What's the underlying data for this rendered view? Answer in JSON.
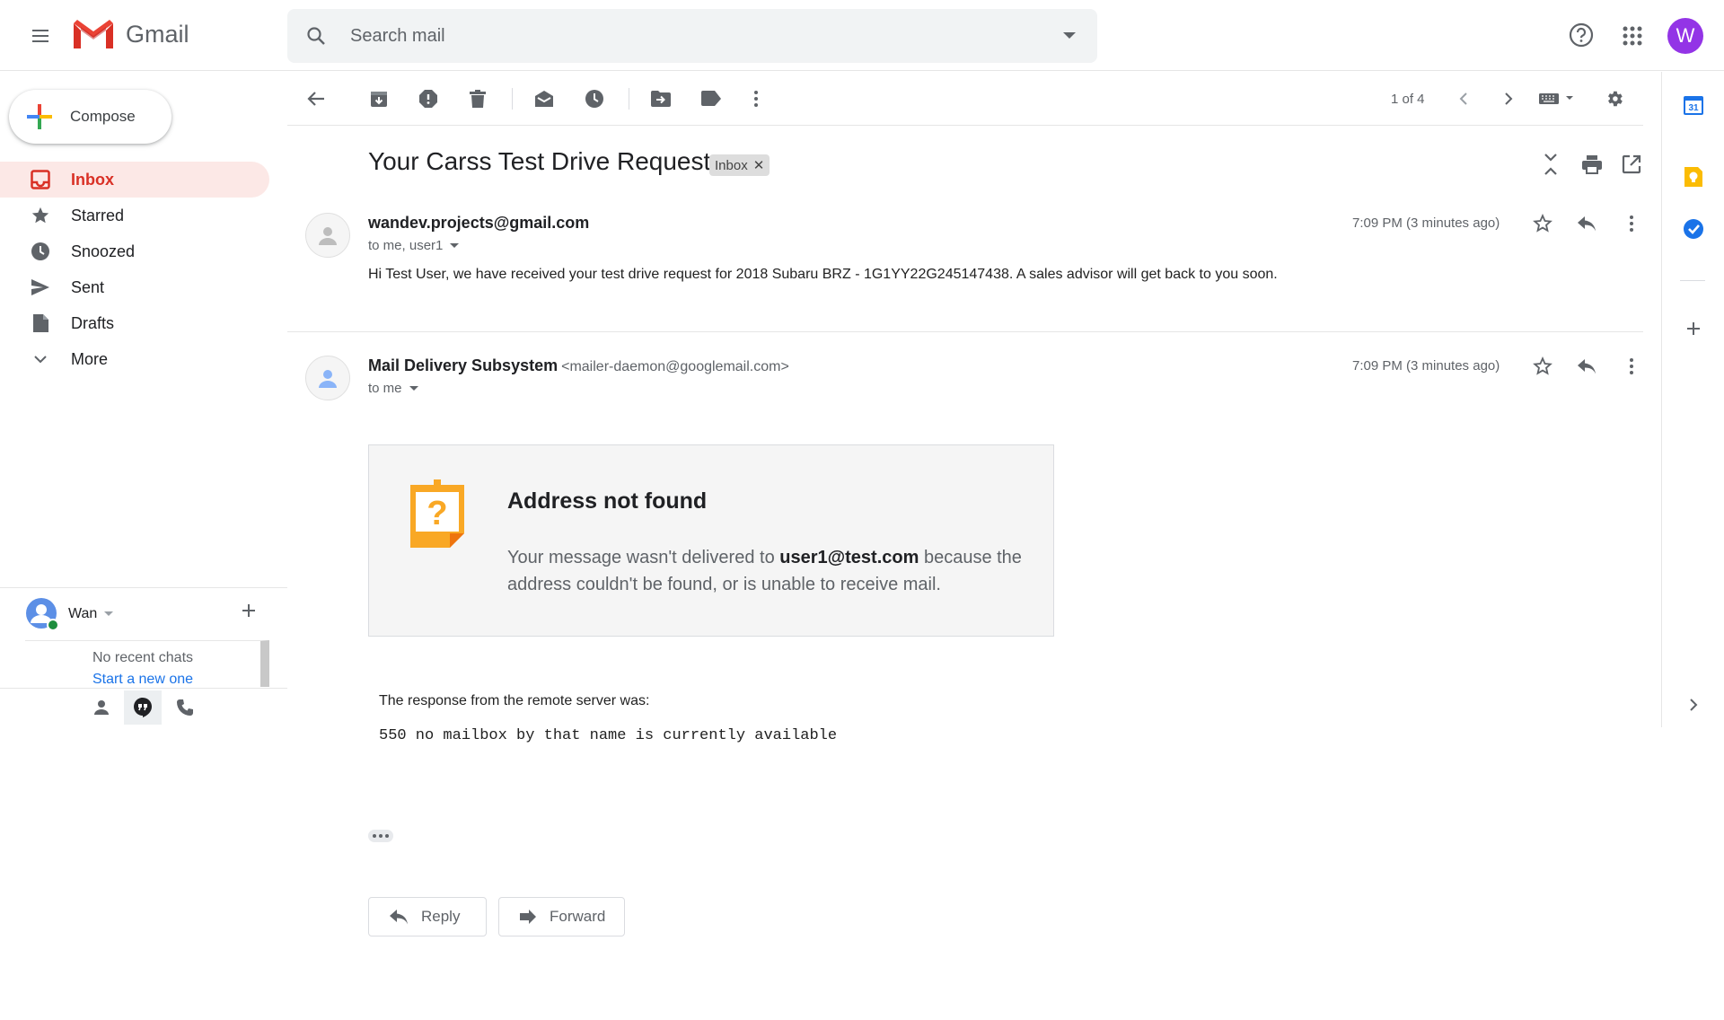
{
  "header": {
    "app_name": "Gmail",
    "search_placeholder": "Search mail",
    "avatar_letter": "W"
  },
  "compose": {
    "label": "Compose"
  },
  "nav": [
    {
      "label": "Inbox",
      "icon": "inbox-icon",
      "active": true
    },
    {
      "label": "Starred",
      "icon": "star-icon"
    },
    {
      "label": "Snoozed",
      "icon": "clock-icon"
    },
    {
      "label": "Sent",
      "icon": "send-icon"
    },
    {
      "label": "Drafts",
      "icon": "draft-icon"
    },
    {
      "label": "More",
      "icon": "chevron-down-icon"
    }
  ],
  "chat": {
    "user": "Wan",
    "no_recent": "No recent chats",
    "start_new": "Start a new one"
  },
  "toolbar": {
    "pager": "1 of 4"
  },
  "thread": {
    "subject": "Your Carss Test Drive Request",
    "label": "Inbox"
  },
  "messages": [
    {
      "sender": "wandev.projects@gmail.com",
      "to": "to me, user1",
      "time": "7:09 PM (3 minutes ago)",
      "body": "Hi Test User, we have received your test drive request for 2018 Subaru BRZ - 1G1YY22G245147438. A sales advisor will get back to you soon."
    },
    {
      "sender": "Mail Delivery Subsystem",
      "sender_email": "<mailer-daemon@googlemail.com>",
      "to": "to me",
      "time": "7:09 PM (3 minutes ago)",
      "bounce_title": "Address not found",
      "bounce_text_pre": "Your message wasn't delivered to ",
      "bounce_address": "user1@test.com",
      "bounce_text_post": " because the address couldn't be found, or is unable to receive mail.",
      "response_label": "The response from the remote server was:",
      "response_code": "550 no mailbox by that name is currently available"
    }
  ],
  "actions": {
    "reply": "Reply",
    "forward": "Forward"
  },
  "side_panel": {
    "calendar_day": "31"
  },
  "colors": {
    "accent_red": "#d93025",
    "active_bg": "#fce8e6",
    "link_blue": "#1a73e8",
    "avatar_purple": "#9334e6",
    "keep_yellow": "#fbbc04"
  }
}
